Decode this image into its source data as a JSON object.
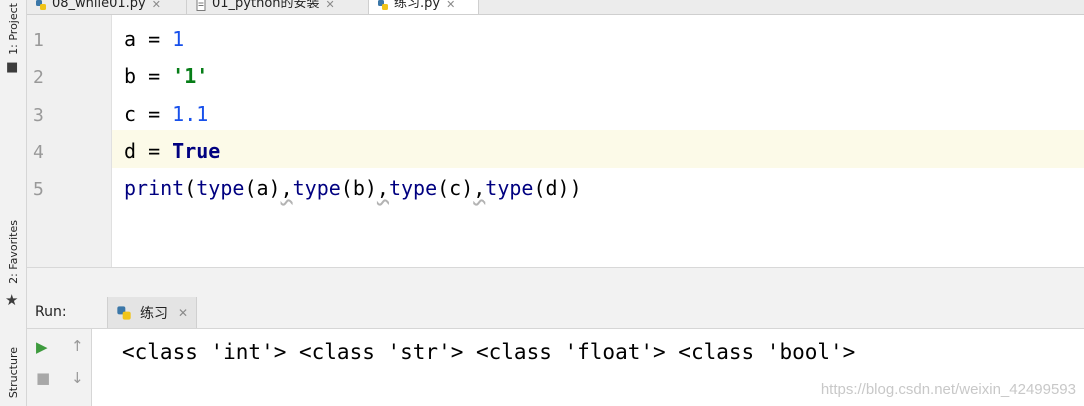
{
  "left_strip": {
    "project_label": "1: Project",
    "favorites_label": "2: Favorites",
    "structure_label": "Structure"
  },
  "tabs": [
    {
      "label": "08_while01.py",
      "active": false
    },
    {
      "label": "01_python的安装",
      "active": false
    },
    {
      "label": "练习.py",
      "active": true
    }
  ],
  "editor": {
    "lines": [
      {
        "number": "1",
        "text": "a = 1"
      },
      {
        "number": "2",
        "text": "b = '1'"
      },
      {
        "number": "3",
        "text": "c = 1.1"
      },
      {
        "number": "4",
        "text": "d = True"
      },
      {
        "number": "5",
        "text": "print(type(a),type(b),type(c),type(d))"
      }
    ],
    "current_line": 4
  },
  "run_panel": {
    "label": "Run:",
    "tab_label": "练习",
    "output": "<class 'int'> <class 'str'> <class 'float'> <class 'bool'>"
  },
  "watermark": "https://blog.csdn.net/weixin_42499593",
  "colors": {
    "number": "#1750eb",
    "string": "#067d17",
    "keyword": "#000080",
    "current_line_bg": "#fcfae8",
    "run_icon": "#3e9b3e"
  },
  "icons": {
    "tab_file": "python-file-icon",
    "run": "play-icon",
    "stop": "stop-icon",
    "up": "arrow-up-icon",
    "down": "arrow-down-icon"
  }
}
